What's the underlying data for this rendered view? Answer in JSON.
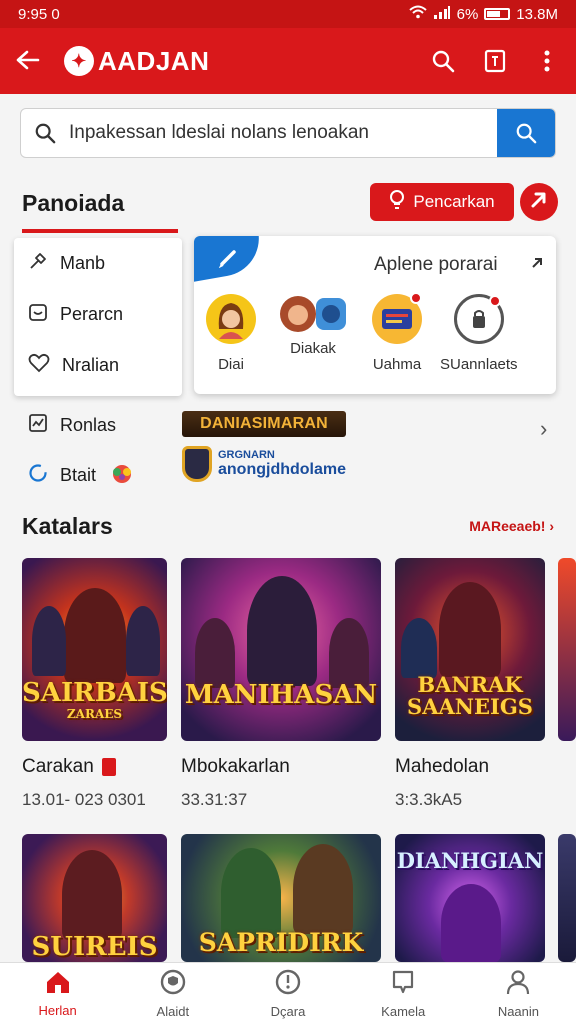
{
  "status": {
    "time": "9:95",
    "time_suffix": "0",
    "battery": "6%",
    "clock": "13.8M"
  },
  "appbar": {
    "brand": "AADJAN"
  },
  "search": {
    "placeholder": "Inpakessan ldeslai nolans lenoakan"
  },
  "section": {
    "title": "Panoiada",
    "find_label": "Pencarkan"
  },
  "menu": {
    "items": [
      {
        "label": "Manb",
        "icon": "tools-icon"
      },
      {
        "label": "Perarcn",
        "icon": "calendar-icon"
      },
      {
        "label": "Nralian",
        "icon": "heart-icon"
      }
    ],
    "extra": [
      {
        "label": "Ronlas",
        "icon": "chart-icon"
      },
      {
        "label": "Btait",
        "icon": "refresh-icon"
      }
    ]
  },
  "suggest": {
    "title": "Aplene porarai",
    "avatars": [
      {
        "label": "Diai"
      },
      {
        "label": "Diakak"
      },
      {
        "label": "Uahma"
      },
      {
        "label": "SUannlaets"
      }
    ]
  },
  "banners": {
    "banner1": "DANIASIMARAN",
    "banner2_top": "GRGNARN",
    "banner2_main": "anongjdhdolame"
  },
  "catalog": {
    "title": "Katalars",
    "more": "MAReeaeb! ›",
    "row1": [
      {
        "art": "SAIRBAIS",
        "art_sub": "ZARAES",
        "name": "Carakan",
        "meta": "13.01- 023 0301"
      },
      {
        "art": "MANIHASAN",
        "art_sub": "",
        "name": "Mbokakarlan",
        "meta": "33.31:37"
      },
      {
        "art": "BANRAK SAANEIGS",
        "art_sub": "",
        "name": "Mahedolan",
        "meta": "3:3.3kA5"
      }
    ],
    "row2": [
      {
        "art": "SUIREIS"
      },
      {
        "art": "SAPRIDIRK"
      },
      {
        "art": "DIANHGIAN"
      }
    ]
  },
  "nav": [
    {
      "label": "Herlan",
      "icon": "home-icon",
      "active": true
    },
    {
      "label": "Alaidt",
      "icon": "shield-icon",
      "active": false
    },
    {
      "label": "Dçara",
      "icon": "compass-icon",
      "active": false
    },
    {
      "label": "Kamela",
      "icon": "chat-icon",
      "active": false
    },
    {
      "label": "Naanin",
      "icon": "user-icon",
      "active": false
    }
  ],
  "colors": {
    "brand_red": "#d9181b",
    "accent_blue": "#1976d2"
  }
}
